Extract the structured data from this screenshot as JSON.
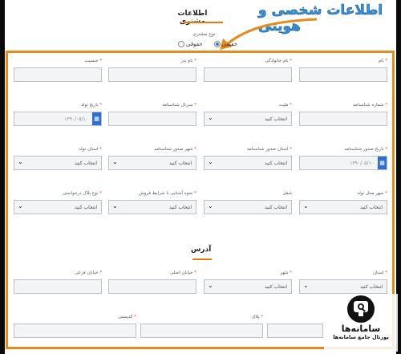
{
  "overlay_title": "اطلاعات شخصی و هویتی",
  "section": {
    "title": "اطلاعات مشتری",
    "customer_type_label": "نوع مشتری",
    "options": [
      {
        "label": "حقیقی",
        "selected": true
      },
      {
        "label": "حقوقی",
        "selected": false
      }
    ]
  },
  "row1": [
    {
      "label": "نام",
      "required": true
    },
    {
      "label": "نام خانوادگی",
      "required": true
    },
    {
      "label": "نام پدر",
      "required": true
    },
    {
      "label": "جنسیت",
      "required": true
    }
  ],
  "row2": [
    {
      "label": "شماره شناسنامه",
      "required": true
    },
    {
      "label": "ملیت",
      "required": true,
      "value": "انتخاب کنید"
    },
    {
      "label": "سریال شناسنامه",
      "required": true
    },
    {
      "label": "تاریخ تولد",
      "required": true,
      "value": "۱۳۹۰/۰۵/۱۰"
    }
  ],
  "row3": [
    {
      "label": "تاریخ صدور شناسنامه",
      "required": true,
      "value": "۱۳۹۰/۰۵/۱۰"
    },
    {
      "label": "استان صدور شناسنامه",
      "required": true,
      "value": "انتخاب کنید"
    },
    {
      "label": "شهر صدور شناسنامه",
      "required": true,
      "value": "انتخاب کنید"
    },
    {
      "label": "استان تولد",
      "required": true,
      "value": "انتخاب کنید"
    }
  ],
  "row4": [
    {
      "label": "شهر محل تولد",
      "required": true,
      "value": "انتخاب کنید"
    },
    {
      "label": "شغل",
      "required": false,
      "value": "انتخاب کنید"
    },
    {
      "label": "نحوه آشنایی با شرایط فروش",
      "required": true,
      "value": "انتخاب کنید"
    },
    {
      "label": "نوع پلاک درخواستی",
      "required": true,
      "value": "انتخاب کنید"
    }
  ],
  "address": {
    "title": "آدرس",
    "row1": [
      {
        "label": "استان",
        "required": true,
        "value": "انتخاب کنید"
      },
      {
        "label": "شهر",
        "required": true,
        "value": "انتخاب کنید"
      },
      {
        "label": "خیابان اصلی",
        "required": true
      },
      {
        "label": "خیابان فرعی",
        "required": true
      }
    ],
    "row2": [
      {
        "label": "پلاک",
        "required": true
      },
      {
        "label": "کدپستی",
        "required": true
      }
    ]
  },
  "logo": {
    "brand": "سامانه‌ها",
    "tagline": "پورتال جامع سامانه‌ها"
  },
  "colors": {
    "accent": "#e68a1d",
    "calendar": "#2f6fd0",
    "overlay_text": "#3a8fd6"
  }
}
